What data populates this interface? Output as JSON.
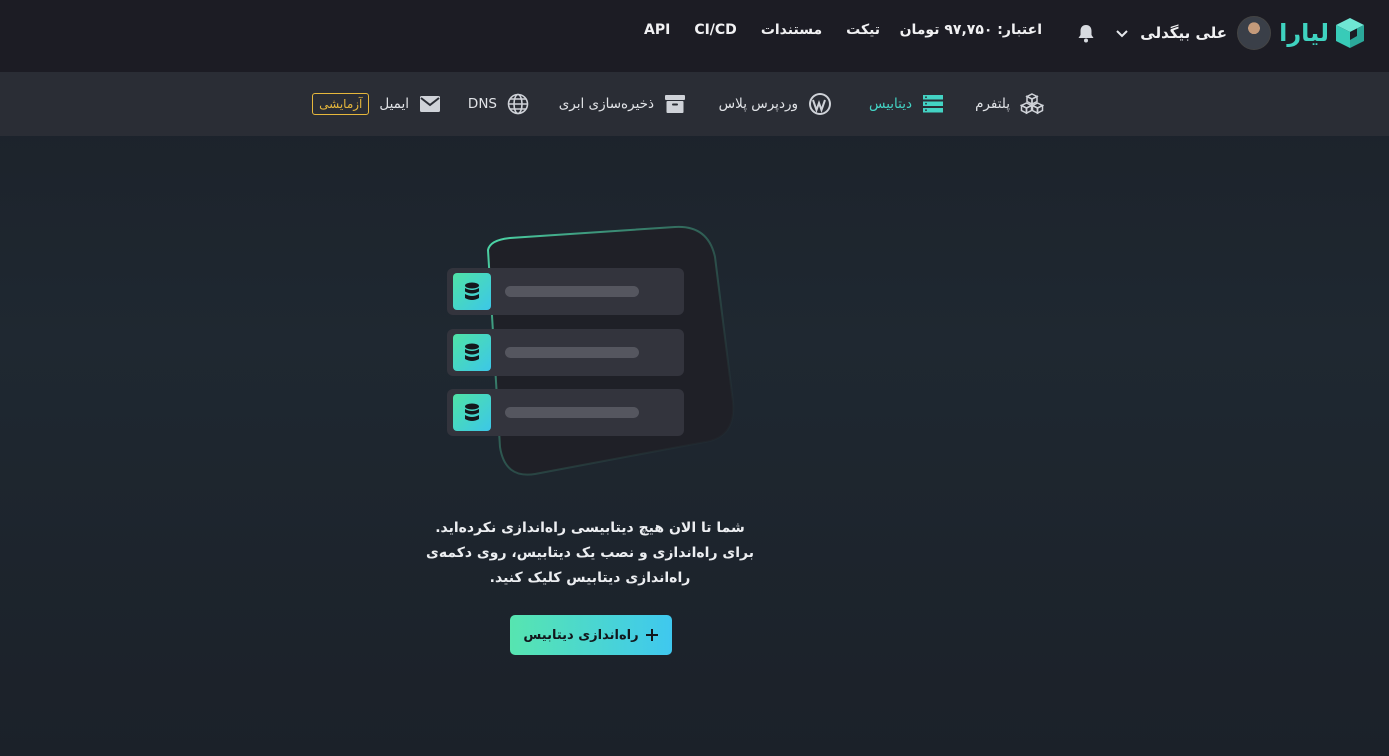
{
  "brand": {
    "name": "لیارا",
    "accent": "#3fd3c0"
  },
  "header": {
    "user_name": "علی بیگدلی",
    "credit": "اعتبار: ۹۷,۷۵۰ تومان",
    "nav": [
      "تیکت",
      "مستندات",
      "CI/CD",
      "API"
    ]
  },
  "subnav": {
    "items": [
      {
        "label": "پلتفرم",
        "icon": "cubes-icon"
      },
      {
        "label": "دیتابیس",
        "icon": "database-servers-icon",
        "active": true
      },
      {
        "label": "وردپرس پلاس",
        "icon": "wordpress-icon"
      },
      {
        "label": "ذخیره‌سازی ابری",
        "icon": "archive-box-icon"
      },
      {
        "label": "DNS",
        "icon": "globe-icon"
      },
      {
        "label": "ایمیل",
        "icon": "envelope-icon",
        "badge": "آزمایشی"
      }
    ]
  },
  "empty_state": {
    "line1": "شما تا الان هیچ دیتابیسی راه‌اندازی نکرده‌اید.",
    "line2": "برای راه‌اندازی و نصب یک دیتابیس، روی دکمه‌ی",
    "line3": "راه‌اندازی دیتابیس کلیک کنید.",
    "button_label": "راه‌اندازی دیتابیس"
  }
}
